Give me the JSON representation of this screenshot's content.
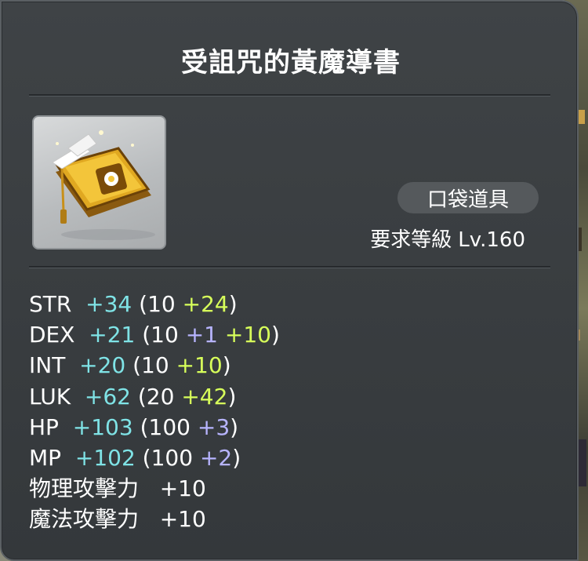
{
  "item": {
    "name": "受詛咒的黃魔導書",
    "icon": "golden-spellbook-icon",
    "type": "口袋道具",
    "req_label": "要求等級",
    "req_value": "Lv.160"
  },
  "stats": [
    {
      "name": "STR",
      "total": "+34",
      "base": "10",
      "parts": [
        {
          "v": "+24",
          "kind": "enh"
        }
      ]
    },
    {
      "name": "DEX",
      "total": "+21",
      "base": "10",
      "parts": [
        {
          "v": "+1",
          "kind": "star"
        },
        {
          "v": "+10",
          "kind": "enh"
        }
      ]
    },
    {
      "name": "INT",
      "total": "+20",
      "base": "10",
      "parts": [
        {
          "v": "+10",
          "kind": "enh"
        }
      ]
    },
    {
      "name": "LUK",
      "total": "+62",
      "base": "20",
      "parts": [
        {
          "v": "+42",
          "kind": "enh"
        }
      ]
    },
    {
      "name": "HP",
      "total": "+103",
      "base": "100",
      "parts": [
        {
          "v": "+3",
          "kind": "star"
        }
      ]
    },
    {
      "name": "MP",
      "total": "+102",
      "base": "100",
      "parts": [
        {
          "v": "+2",
          "kind": "star"
        }
      ]
    },
    {
      "name": "物理攻擊力",
      "total": "+10",
      "base": "",
      "parts": []
    },
    {
      "name": "魔法攻擊力",
      "total": "+10",
      "base": "",
      "parts": []
    }
  ],
  "colors": {
    "total": "#7fe3e6",
    "enhance": "#d7ff5a",
    "star": "#b7b4ff",
    "panel": "#3a3e41"
  }
}
